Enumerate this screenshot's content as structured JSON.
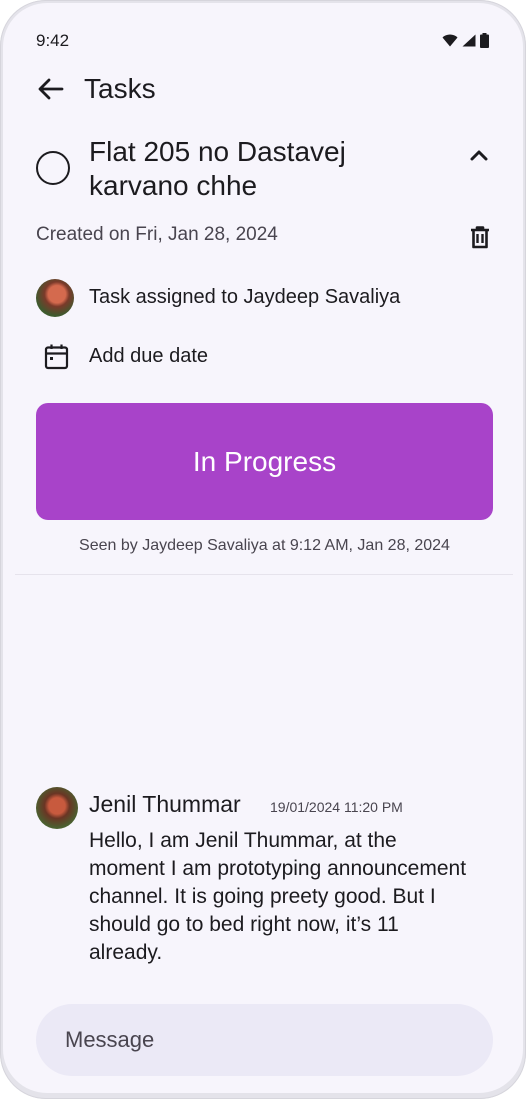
{
  "status_bar": {
    "time": "9:42",
    "icons": [
      "wifi-icon",
      "signal-icon",
      "battery-icon"
    ]
  },
  "app_bar": {
    "title": "Tasks",
    "back_icon": "arrow-back-icon"
  },
  "task": {
    "title": "Flat 205 no Dastavej karvano chhe",
    "created": "Created on Fri, Jan 28, 2024",
    "assigned": "Task assigned to Jaydeep Savaliya",
    "due_label": "Add due date",
    "status_label": "In Progress",
    "seen": "Seen by Jaydeep Savaliya at 9:12 AM, Jan 28, 2024"
  },
  "colors": {
    "status_button": "#a843c9",
    "background": "#f7f5fc",
    "composer": "#ebe9f6"
  },
  "messages": [
    {
      "author": "Jenil Thummar",
      "time": "19/01/2024 11:20 PM",
      "body": "Hello, I am Jenil Thummar, at the moment I am prototyping announcement channel. It is going preety good. But I should go to bed right now, it’s 11 already."
    }
  ],
  "composer": {
    "placeholder": "Message",
    "value": ""
  }
}
